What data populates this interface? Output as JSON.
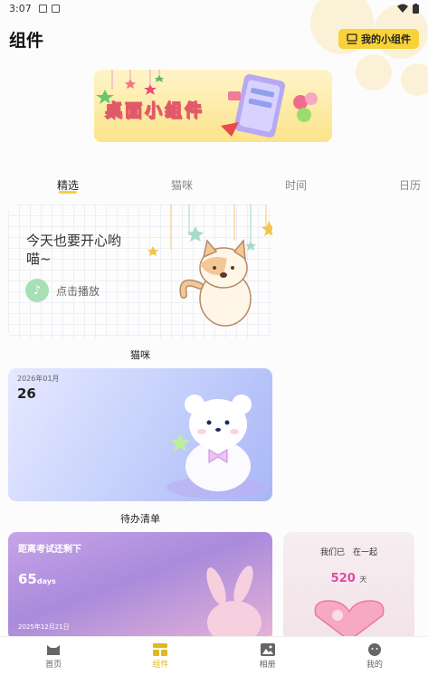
{
  "statusbar": {
    "time": "3:07"
  },
  "header": {
    "title": "组件",
    "my_widget_label": "我的小组件"
  },
  "banner": {
    "text": "桌面小组件"
  },
  "tabs": [
    {
      "label": "精选",
      "active": true
    },
    {
      "label": "猫咪",
      "active": false
    },
    {
      "label": "时间",
      "active": false
    },
    {
      "label": "日历",
      "active": false
    }
  ],
  "cards": {
    "cat": {
      "title_line1": "今天也要开心哟",
      "title_line2": "喵~",
      "play_label": "点击播放",
      "caption": "猫咪"
    },
    "todo": {
      "date": "2026年01月",
      "day": "26",
      "caption": "待办清单"
    },
    "exam": {
      "title": "距离考试还剩下",
      "days_num": "65",
      "days_unit": "days",
      "date": "2025年12月21日"
    },
    "together": {
      "title": "我们已　在一起",
      "num": "520",
      "unit": "天"
    }
  },
  "bottom_nav": [
    {
      "label": "首页",
      "icon": "cat-face-icon",
      "active": false
    },
    {
      "label": "组件",
      "icon": "widget-grid-icon",
      "active": true
    },
    {
      "label": "相册",
      "icon": "photo-icon",
      "active": false
    },
    {
      "label": "我的",
      "icon": "face-icon",
      "active": false
    }
  ],
  "colors": {
    "accent": "#f8d23a",
    "active_nav": "#e0b81e"
  }
}
